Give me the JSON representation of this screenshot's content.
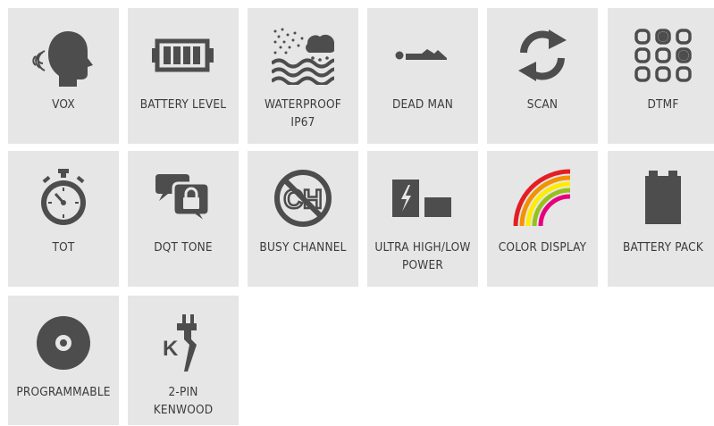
{
  "features": [
    {
      "key": "vox",
      "icon": "vox-head-icon",
      "lines": [
        "VOX"
      ]
    },
    {
      "key": "battery-level",
      "icon": "battery-level-icon",
      "lines": [
        "BATTERY LEVEL"
      ]
    },
    {
      "key": "waterproof",
      "icon": "waterproof-icon",
      "lines": [
        "WATERPROOF",
        "IP67"
      ]
    },
    {
      "key": "dead-man",
      "icon": "dead-man-icon",
      "lines": [
        "DEAD MAN"
      ]
    },
    {
      "key": "scan",
      "icon": "scan-arrows-icon",
      "lines": [
        "SCAN"
      ]
    },
    {
      "key": "dtmf",
      "icon": "dtmf-keypad-icon",
      "lines": [
        "DTMF"
      ]
    },
    {
      "key": "tot",
      "icon": "stopwatch-icon",
      "lines": [
        "TOT"
      ]
    },
    {
      "key": "dqt-tone",
      "icon": "chat-lock-icon",
      "lines": [
        "DQT TONE"
      ]
    },
    {
      "key": "busy-channel",
      "icon": "busy-channel-icon",
      "lines": [
        "BUSY CHANNEL"
      ]
    },
    {
      "key": "ultra-high-low-power",
      "icon": "power-level-icon",
      "lines": [
        "ULTRA HIGH/LOW",
        "POWER"
      ]
    },
    {
      "key": "color-display",
      "icon": "rainbow-icon",
      "lines": [
        "COLOR DISPLAY"
      ]
    },
    {
      "key": "battery-pack",
      "icon": "battery-pack-icon",
      "lines": [
        "BATTERY PACK"
      ]
    },
    {
      "key": "programmable",
      "icon": "disc-icon",
      "lines": [
        "PROGRAMMABLE"
      ]
    },
    {
      "key": "2-pin-kenwood",
      "icon": "kenwood-2pin-icon",
      "lines": [
        "2-PIN",
        "KENWOOD"
      ]
    }
  ],
  "icon_texts": {
    "busy_channel": "CH",
    "kenwood_letter": "K"
  },
  "colors": {
    "tile_bg": "#e6e6e6",
    "icon": "#4d4d4d",
    "text": "#3b3b3b",
    "rainbow": [
      "#e31e24",
      "#f39200",
      "#ffed00",
      "#95c11f",
      "#e6007e"
    ]
  }
}
